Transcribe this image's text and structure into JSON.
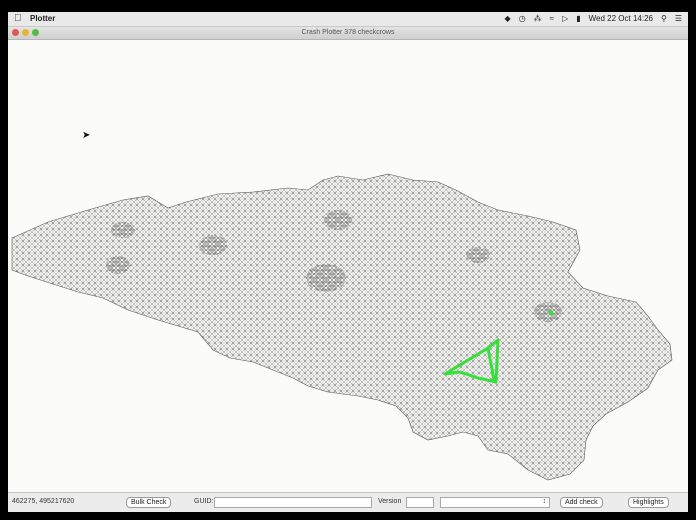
{
  "menubar": {
    "app_name": "Plotter",
    "clock": "Wed 22 Oct 14:26"
  },
  "window": {
    "title": "Crash Plotter    378 checkcrows"
  },
  "statusbar": {
    "coordinates": "462275, 495217620",
    "bulk_check_label": "Bulk Check",
    "guid_label": "GUID:",
    "guid_value": "",
    "version_label": "Version",
    "version_value": "",
    "dropdown_value": "",
    "add_check_label": "Add check",
    "highlights_label": "Highlights"
  },
  "colors": {
    "network": "#3a3a3a",
    "highlight": "#35e03a",
    "canvas": "#fbfbfa"
  }
}
